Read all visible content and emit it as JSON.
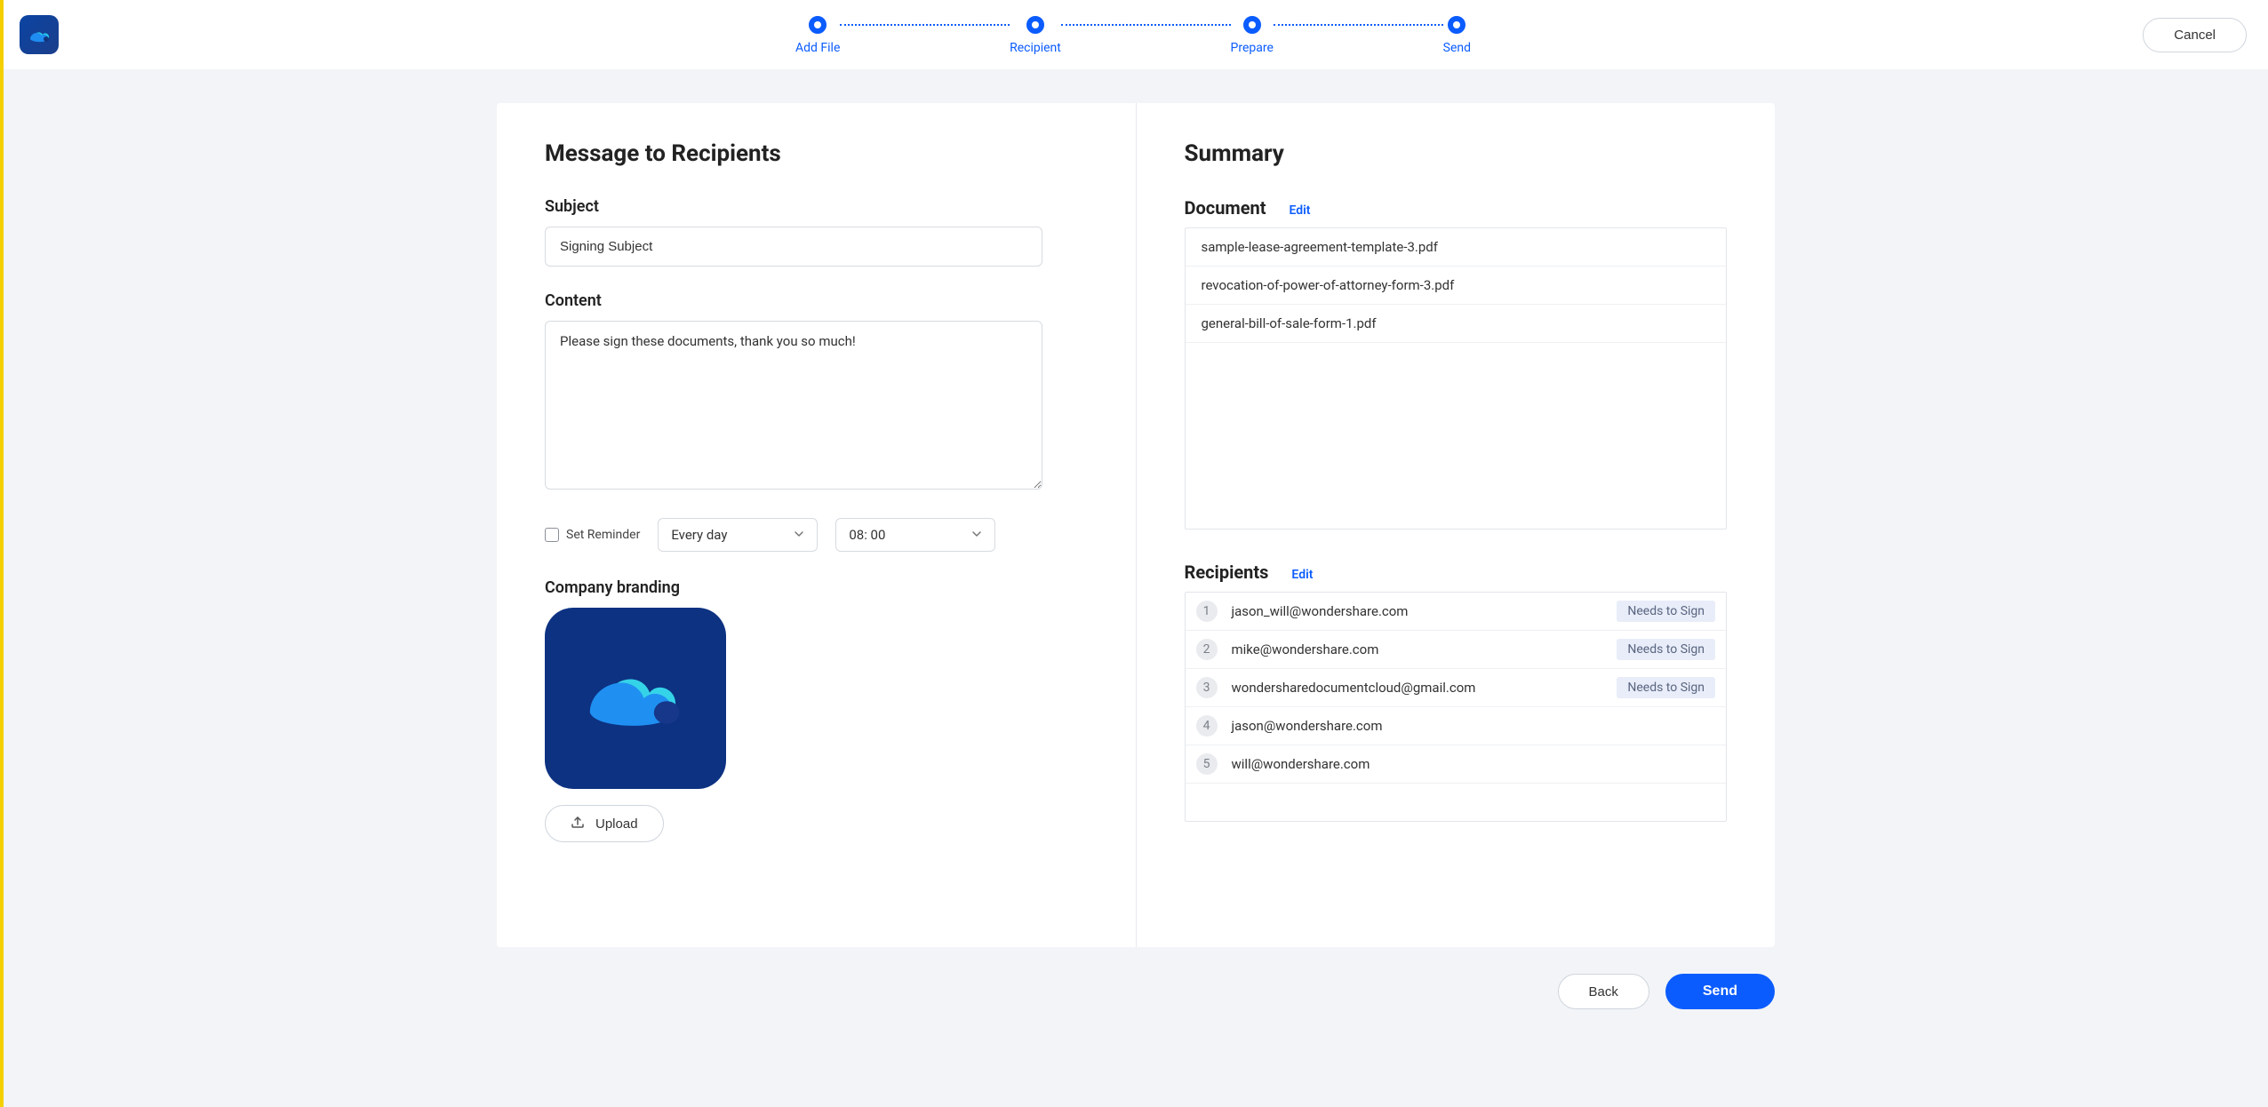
{
  "header": {
    "steps": [
      {
        "label": "Add File"
      },
      {
        "label": "Recipient"
      },
      {
        "label": "Prepare"
      },
      {
        "label": "Send"
      }
    ],
    "cancel_label": "Cancel"
  },
  "left": {
    "title": "Message to Recipients",
    "subject_label": "Subject",
    "subject_value": "Signing Subject",
    "content_label": "Content",
    "content_value": "Please sign these documents, thank you so much!",
    "set_reminder_label": "Set Reminder",
    "reminder_freq": "Every day",
    "reminder_time": "08: 00",
    "branding_label": "Company branding",
    "upload_label": "Upload"
  },
  "right": {
    "title": "Summary",
    "document_label": "Document",
    "edit_label": "Edit",
    "documents": [
      "sample-lease-agreement-template-3.pdf",
      "revocation-of-power-of-attorney-form-3.pdf",
      "general-bill-of-sale-form-1.pdf"
    ],
    "recipients_label": "Recipients",
    "recipients": [
      {
        "order": "1",
        "email": "jason_will@wondershare.com",
        "action": "Needs to Sign"
      },
      {
        "order": "2",
        "email": "mike@wondershare.com",
        "action": "Needs to Sign"
      },
      {
        "order": "3",
        "email": "wondersharedocumentcloud@gmail.com",
        "action": "Needs to Sign"
      },
      {
        "order": "4",
        "email": "jason@wondershare.com",
        "action": ""
      },
      {
        "order": "5",
        "email": "will@wondershare.com",
        "action": ""
      }
    ]
  },
  "footer": {
    "back_label": "Back",
    "send_label": "Send"
  }
}
